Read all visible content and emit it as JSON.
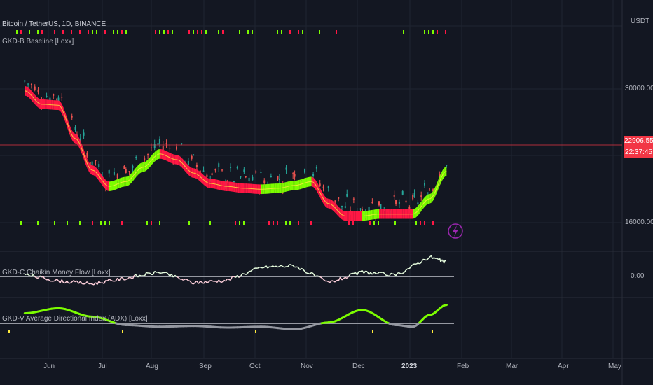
{
  "header": {
    "symbol": "Bitcoin / TetherUS, 1D, BINANCE",
    "overlay_indicator": "GKD-B Baseline [Loxx]",
    "currency": "USDT"
  },
  "price_axis": {
    "ticks": [
      "30000.00",
      "16000.00"
    ],
    "last_price": "22906.55",
    "countdown": "22:37:45"
  },
  "panes": {
    "cmf_title": "GKD-C Chaikin Money Flow [Loxx]",
    "cmf_tick": "0.00",
    "adx_title": "GKD-V Average Directional Index (ADX) [Loxx]"
  },
  "time_axis": {
    "labels": [
      "Jun",
      "Jul",
      "Aug",
      "Sep",
      "Oct",
      "Nov",
      "Dec",
      "2023",
      "Feb",
      "Mar",
      "Apr",
      "May"
    ]
  },
  "colors": {
    "background": "#131722",
    "bull": "#7cfc00",
    "bear": "#ff1744",
    "band_edge": "#ffeb3b",
    "candle_up": "#26a69a",
    "candle_down": "#ef5350",
    "price_line": "#f23645",
    "neutral_line": "#9598a1",
    "lightning": "#9c27b0"
  },
  "chart_data": [
    {
      "type": "line",
      "title": "GKD-B Baseline [Loxx]",
      "x": [
        "May-18",
        "May-28",
        "Jun-07",
        "Jun-17",
        "Jun-27",
        "Jul-07",
        "Jul-17",
        "Jul-27",
        "Aug-06",
        "Aug-16",
        "Aug-26",
        "Sep-05",
        "Sep-15",
        "Sep-25",
        "Oct-05",
        "Oct-15",
        "Oct-25",
        "Nov-04",
        "Nov-14",
        "Nov-24",
        "Dec-04",
        "Dec-14",
        "Dec-24",
        "Jan-03",
        "Jan-13",
        "Jan-23"
      ],
      "series": [
        {
          "values": [
            29800,
            28400,
            28300,
            24800,
            21500,
            19800,
            20300,
            21800,
            23200,
            22600,
            21200,
            20100,
            19800,
            19600,
            19500,
            19600,
            19900,
            20300,
            18000,
            16700,
            16700,
            16900,
            16900,
            16900,
            18500,
            21400
          ]
        }
      ],
      "ylim": [
        15000,
        33000
      ]
    },
    {
      "type": "line",
      "title": "GKD-C Chaikin Money Flow [Loxx]",
      "x": [
        "May-18",
        "Jun-07",
        "Jun-27",
        "Jul-17",
        "Aug-06",
        "Aug-26",
        "Sep-15",
        "Oct-05",
        "Oct-25",
        "Nov-14",
        "Dec-04",
        "Dec-24",
        "Jan-13",
        "Jan-23"
      ],
      "series": [
        {
          "values": [
            0.02,
            -0.05,
            -0.08,
            -0.02,
            0.05,
            -0.07,
            -0.04,
            0.1,
            0.12,
            -0.07,
            0.05,
            0.01,
            0.22,
            0.15
          ]
        }
      ]
    },
    {
      "type": "line",
      "title": "GKD-V Average Directional Index (ADX) [Loxx]",
      "x": [
        "May-18",
        "Jun-07",
        "Jun-27",
        "Jul-17",
        "Aug-06",
        "Aug-26",
        "Sep-15",
        "Oct-05",
        "Oct-25",
        "Nov-14",
        "Dec-04",
        "Dec-24",
        "Jan-03",
        "Jan-13",
        "Jan-23"
      ],
      "series": [
        {
          "values": [
            32,
            38,
            28,
            18,
            16,
            17,
            15,
            16,
            13,
            21,
            36,
            18,
            16,
            30,
            42
          ]
        }
      ]
    }
  ]
}
